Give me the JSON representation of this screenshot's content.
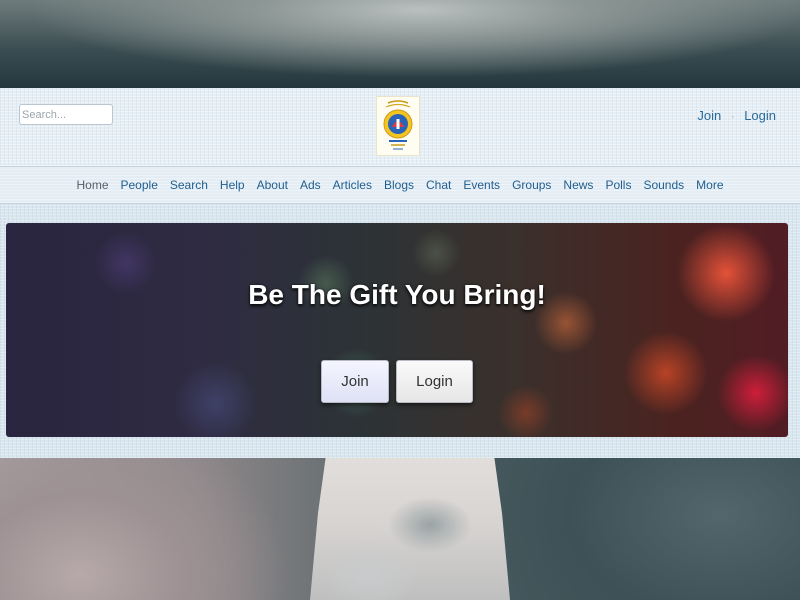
{
  "header": {
    "search_placeholder": "Search...",
    "auth_links": {
      "join": "Join",
      "separator": "·",
      "login": "Login"
    }
  },
  "nav": {
    "items": [
      {
        "label": "Home",
        "active": true
      },
      {
        "label": "People"
      },
      {
        "label": "Search"
      },
      {
        "label": "Help"
      },
      {
        "label": "About"
      },
      {
        "label": "Ads"
      },
      {
        "label": "Articles"
      },
      {
        "label": "Blogs"
      },
      {
        "label": "Chat"
      },
      {
        "label": "Events"
      },
      {
        "label": "Groups"
      },
      {
        "label": "News"
      },
      {
        "label": "Polls"
      },
      {
        "label": "Sounds"
      },
      {
        "label": "More"
      }
    ]
  },
  "hero": {
    "title": "Be The Gift You Bring!",
    "join_label": "Join",
    "login_label": "Login"
  },
  "colors": {
    "link": "#1f5e8f",
    "nav_active": "#55606a",
    "hero_text": "#ffffff"
  }
}
